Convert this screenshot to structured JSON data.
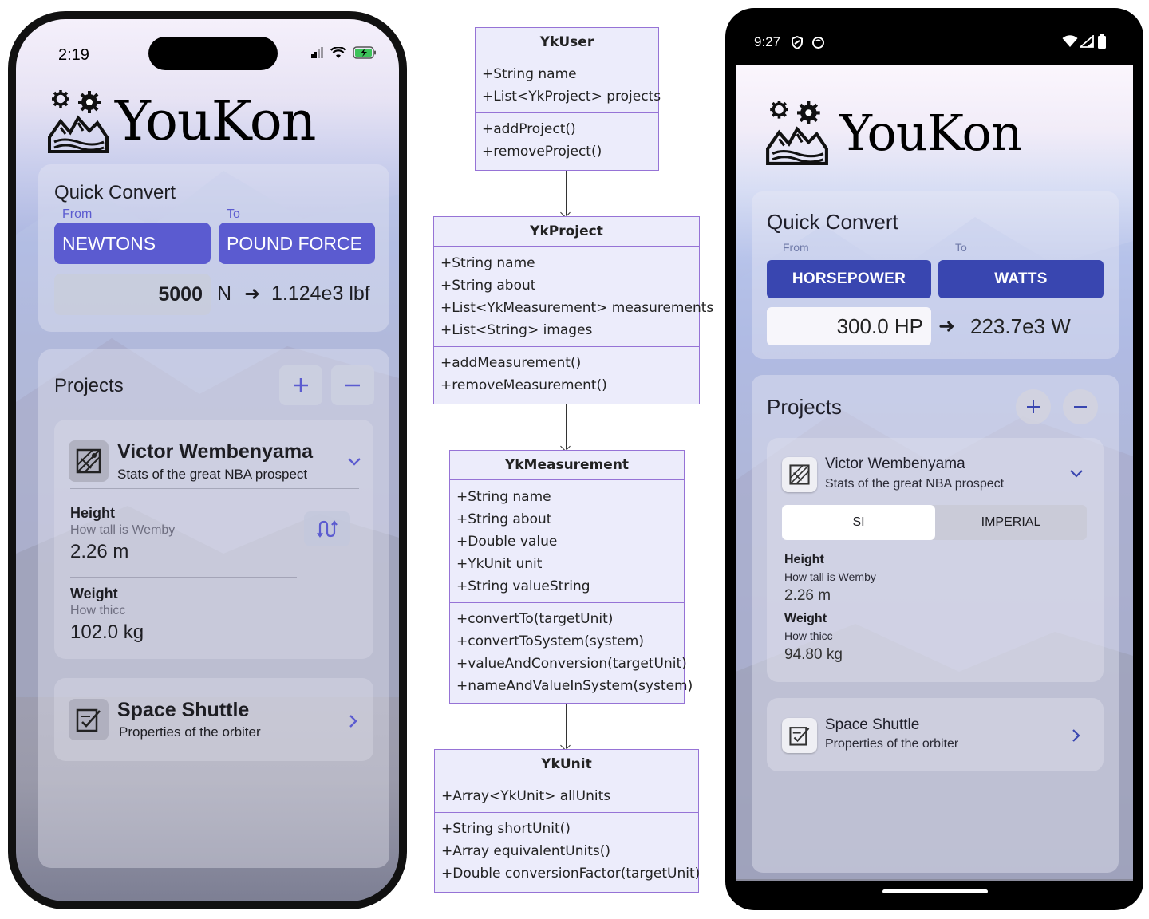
{
  "ios": {
    "status_time": "2:19",
    "app_name": "YouKon",
    "quick_convert": {
      "title": "Quick Convert",
      "from_label": "From",
      "to_label": "To",
      "from_unit": "NEWTONS",
      "to_unit": "POUND FORCE",
      "input_value": "5000",
      "input_unit": "N",
      "arrow": "➜",
      "result": "1.124e3 lbf"
    },
    "projects": {
      "title": "Projects",
      "items": [
        {
          "name": "Victor Wembenyama",
          "description": "Stats of the great NBA prospect",
          "measurements": [
            {
              "name": "Height",
              "about": "How tall is Wemby",
              "value": "2.26 m"
            },
            {
              "name": "Weight",
              "about": "How thicc",
              "value": "102.0 kg"
            }
          ]
        },
        {
          "name": "Space Shuttle",
          "description": "Properties of the orbiter"
        }
      ]
    }
  },
  "uml": {
    "classes": [
      {
        "name": "YkUser",
        "attributes": [
          "+String name",
          "+List<YkProject> projects"
        ],
        "methods": [
          "+addProject()",
          "+removeProject()"
        ]
      },
      {
        "name": "YkProject",
        "attributes": [
          "+String name",
          "+String about",
          "+List<YkMeasurement> measurements",
          "+List<String> images"
        ],
        "methods": [
          "+addMeasurement()",
          "+removeMeasurement()"
        ]
      },
      {
        "name": "YkMeasurement",
        "attributes": [
          "+String name",
          "+String about",
          "+Double value",
          "+YkUnit unit",
          "+String valueString"
        ],
        "methods": [
          "+convertTo(targetUnit)",
          "+convertToSystem(system)",
          "+valueAndConversion(targetUnit)",
          "+nameAndValueInSystem(system)"
        ]
      },
      {
        "name": "YkUnit",
        "attributes": [
          "+Array<YkUnit> allUnits"
        ],
        "methods": [
          "+String shortUnit()",
          "+Array equivalentUnits()",
          "+Double conversionFactor(targetUnit)"
        ]
      }
    ]
  },
  "android": {
    "status_time": "9:27",
    "app_name": "YouKon",
    "quick_convert": {
      "title": "Quick Convert",
      "from_label": "From",
      "to_label": "To",
      "from_unit": "HORSEPOWER",
      "to_unit": "WATTS",
      "input_value": "300.0 HP",
      "arrow": "➜",
      "result": "223.7e3 W"
    },
    "projects": {
      "title": "Projects",
      "items": [
        {
          "name": "Victor Wembenyama",
          "description": "Stats of the great NBA prospect",
          "segments": [
            "SI",
            "IMPERIAL"
          ],
          "selected_segment": "SI",
          "measurements": [
            {
              "name": "Height",
              "about": "How tall is Wemby",
              "value": "2.26 m"
            },
            {
              "name": "Weight",
              "about": "How thicc",
              "value": "94.80 kg"
            }
          ]
        },
        {
          "name": "Space Shuttle",
          "description": "Properties of the orbiter"
        }
      ]
    }
  },
  "colors": {
    "ios_accent": "#5b5bd0",
    "android_accent": "#3946b0",
    "uml_fill": "#ececfb",
    "uml_border": "#9673d6"
  }
}
